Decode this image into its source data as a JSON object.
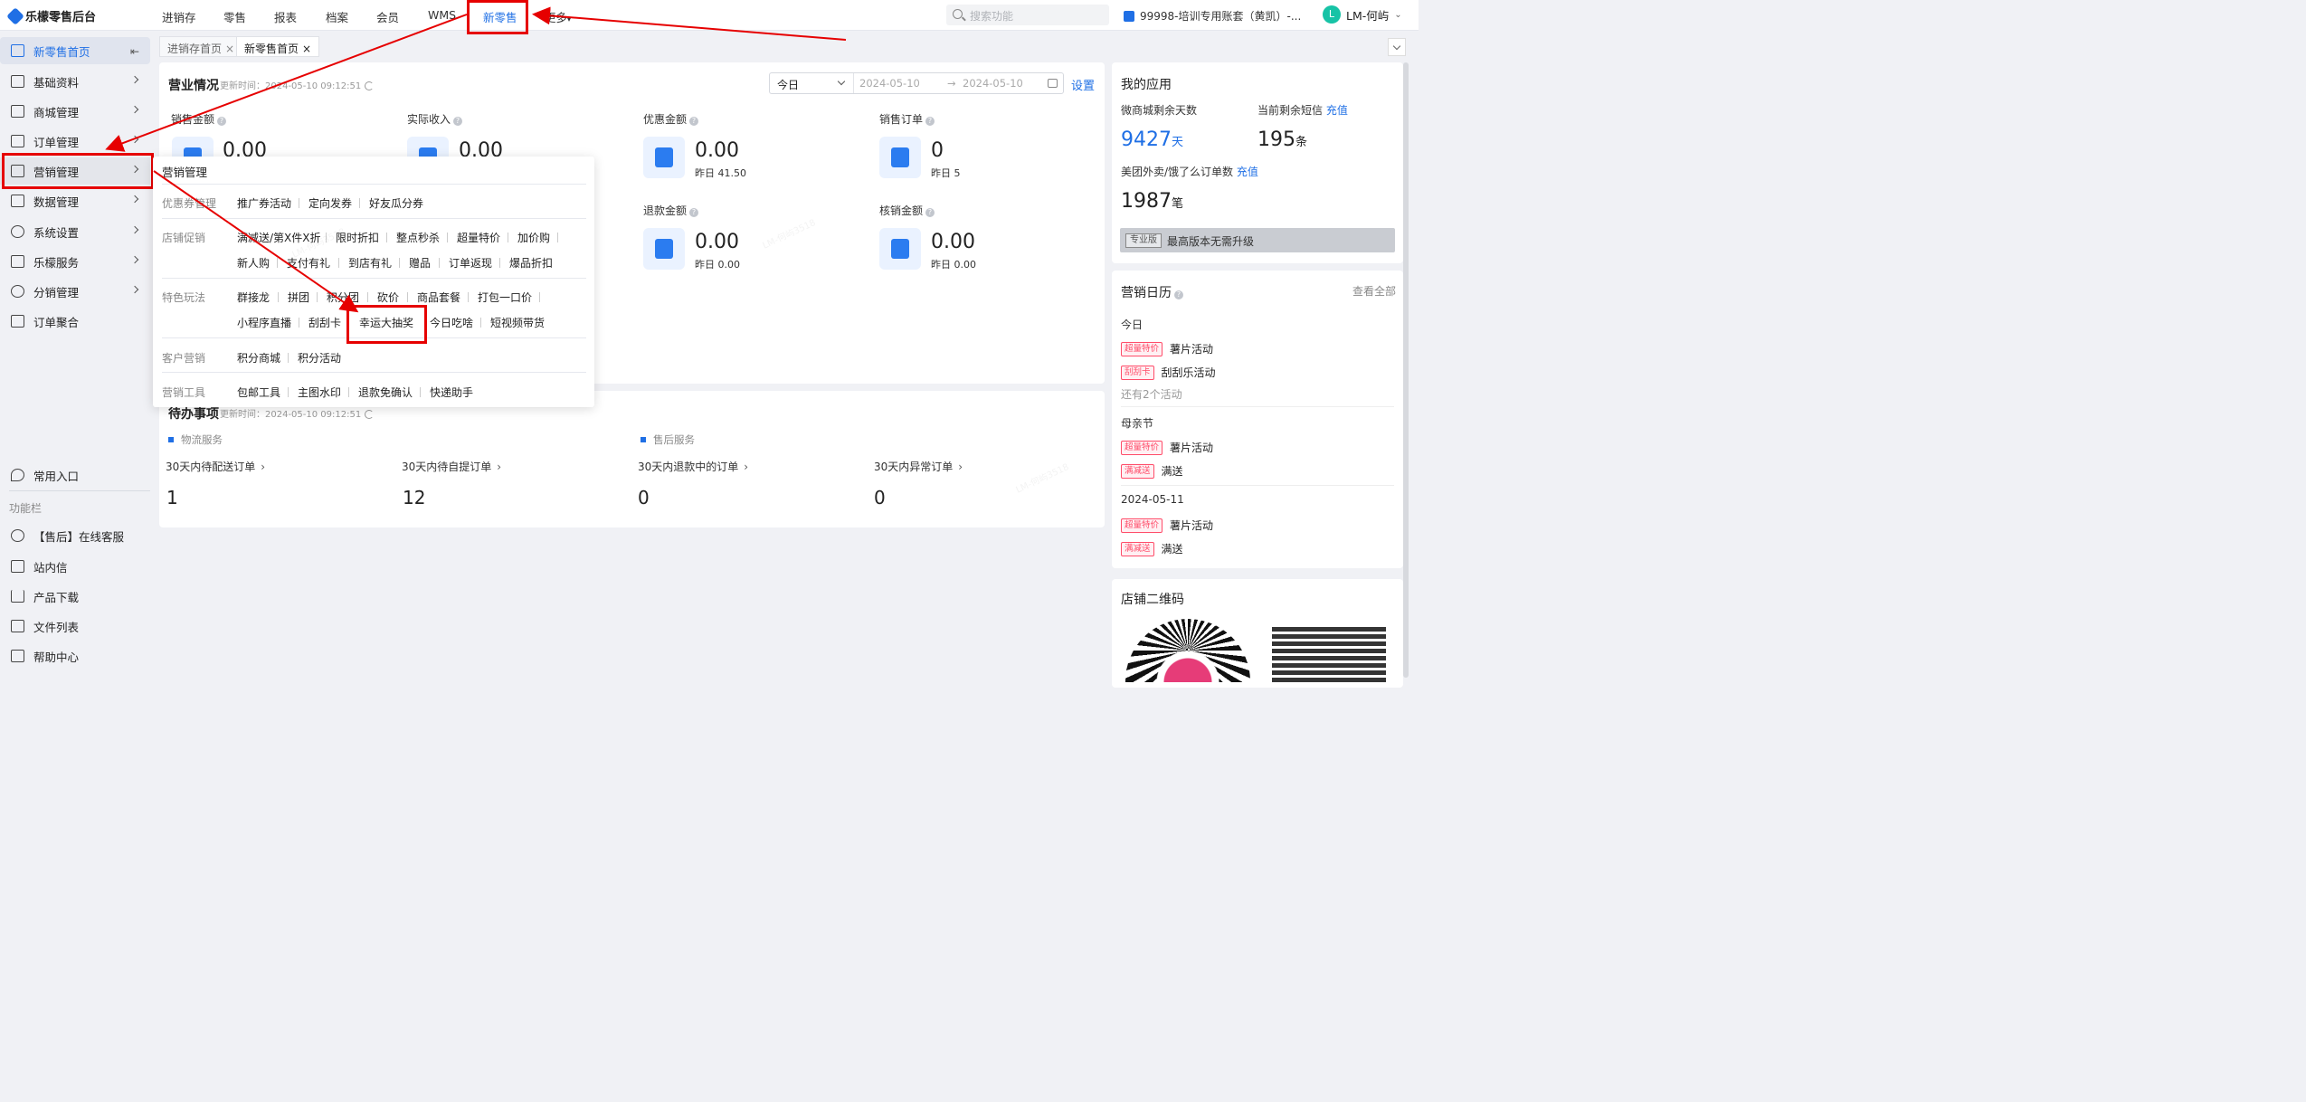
{
  "topbar": {
    "logo": "乐檬零售后台",
    "nav": [
      "进销存",
      "零售",
      "报表",
      "档案",
      "会员",
      "WMS",
      "新零售",
      "更多"
    ],
    "search_placeholder": "搜索功能",
    "account": "99998-培训专用账套（黄凯）-...",
    "avatar_letter": "L",
    "user": "LM-何屿"
  },
  "sidebar": {
    "items": [
      "新零售首页",
      "基础资料",
      "商城管理",
      "订单管理",
      "营销管理",
      "数据管理",
      "系统设置",
      "乐檬服务",
      "分销管理",
      "订单聚合"
    ],
    "collapse_icon": "⇤",
    "common": "常用入口",
    "func_label": "功能栏",
    "func_items": [
      "【售后】在线客服",
      "站内信",
      "产品下载",
      "文件列表",
      "帮助中心"
    ]
  },
  "tabs": [
    {
      "label": "进销存首页",
      "close": "×"
    },
    {
      "label": "新零售首页",
      "close": "×"
    }
  ],
  "business": {
    "title": "营业情况",
    "updated": "更新时间：2024-05-10 09:12:51",
    "period": "今日",
    "date_from": "2024-05-10",
    "date_arrow": "→",
    "date_to": "2024-05-10",
    "settings": "设置",
    "metrics": [
      {
        "label": "销售金额",
        "value": "0.00",
        "sub": ""
      },
      {
        "label": "实际收入",
        "value": "0.00",
        "sub": ""
      },
      {
        "label": "优惠金额",
        "value": "0.00",
        "sub": "昨日 41.50"
      },
      {
        "label": "销售订单",
        "value": "0",
        "sub": "昨日 5"
      },
      {
        "label": "退款金额",
        "value": "0.00",
        "sub": "昨日 0.00"
      },
      {
        "label": "核销金额",
        "value": "0.00",
        "sub": "昨日 0.00"
      }
    ]
  },
  "todo": {
    "title": "待办事项",
    "updated": "更新时间：2024-05-10 09:12:51",
    "sections": [
      "物流服务",
      "售后服务"
    ],
    "items": [
      {
        "label": "30天内待配送订单",
        "value": "1"
      },
      {
        "label": "30天内待自提订单",
        "value": "12"
      },
      {
        "label": "30天内退款中的订单",
        "value": "0"
      },
      {
        "label": "30天内异常订单",
        "value": "0"
      }
    ]
  },
  "apps": {
    "title": "我的应用",
    "mall_days_label": "微商城剩余天数",
    "mall_days": "9427",
    "mall_days_unit": "天",
    "sms_label": "当前剩余短信",
    "recharge": "充值",
    "sms": "195",
    "sms_unit": "条",
    "takeout_label": "美团外卖/饿了么订单数",
    "takeout": "1987",
    "takeout_unit": "笔",
    "upgrade_tag": "专业版",
    "upgrade_text": "最高版本无需升级"
  },
  "calendar": {
    "title": "营销日历",
    "view_all": "查看全部",
    "groups": [
      {
        "date": "今日",
        "items": [
          {
            "tag": "超量特价",
            "name": "薯片活动"
          },
          {
            "tag": "刮刮卡",
            "name": "刮刮乐活动"
          }
        ],
        "more": "还有2个活动"
      },
      {
        "date": "母亲节",
        "items": [
          {
            "tag": "超量特价",
            "name": "薯片活动"
          },
          {
            "tag": "满减送",
            "name": "满送"
          }
        ],
        "more": ""
      },
      {
        "date": "2024-05-11",
        "items": [
          {
            "tag": "超量特价",
            "name": "薯片活动"
          },
          {
            "tag": "满减送",
            "name": "满送"
          }
        ],
        "more": ""
      }
    ]
  },
  "qrcode": {
    "title": "店铺二维码"
  },
  "dropdown": {
    "title": "营销管理",
    "rows": [
      {
        "category": "优惠券管理",
        "lines": [
          [
            "推广券活动",
            "定向发券",
            "好友瓜分券"
          ]
        ]
      },
      {
        "category": "店铺促销",
        "lines": [
          [
            "满减送/第X件X折",
            "限时折扣",
            "整点秒杀",
            "超量特价",
            "加价购"
          ],
          [
            "新人购",
            "支付有礼",
            "到店有礼",
            "赠品",
            "订单返现",
            "爆品折扣"
          ]
        ]
      },
      {
        "category": "特色玩法",
        "lines": [
          [
            "群接龙",
            "拼团",
            "积分团",
            "砍价",
            "商品套餐",
            "打包一口价"
          ],
          [
            "小程序直播",
            "刮刮卡",
            "幸运大抽奖",
            "今日吃啥",
            "短视频带货"
          ]
        ]
      },
      {
        "category": "客户营销",
        "lines": [
          [
            "积分商城",
            "积分活动"
          ]
        ]
      },
      {
        "category": "营销工具",
        "lines": [
          [
            "包邮工具",
            "主图水印",
            "退款免确认",
            "快递助手"
          ]
        ]
      }
    ]
  },
  "watermark": "LM-何屿3518",
  "colors": {
    "accent": "#1f6fe5",
    "annotation": "#e60000",
    "tag": "#ff4d6a"
  }
}
